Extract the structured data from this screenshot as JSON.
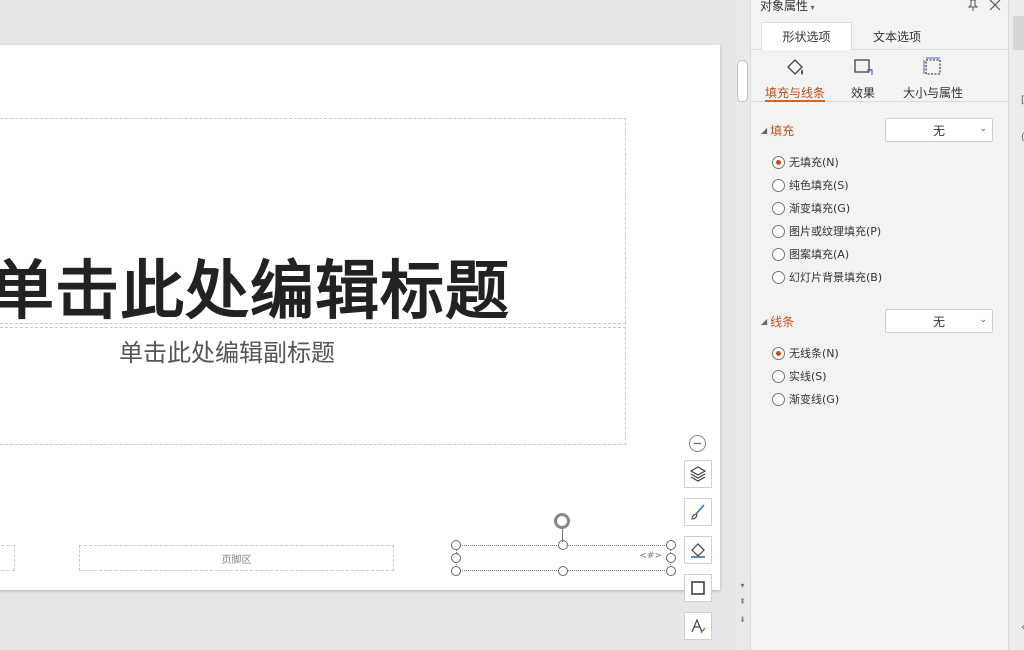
{
  "slide": {
    "title_text": "单击此处编辑标题",
    "subtitle_text": "单击此处编辑副标题",
    "footer_text": "页脚区",
    "number_text": "<#>"
  },
  "panel": {
    "title": "对象属性",
    "tabs": [
      {
        "label": "形状选项",
        "active": true
      },
      {
        "label": "文本选项",
        "active": false
      }
    ],
    "subtabs": [
      {
        "label": "填充与线条",
        "icon": "fill-line-icon",
        "active": true
      },
      {
        "label": "效果",
        "icon": "effect-icon",
        "active": false
      },
      {
        "label": "大小与属性",
        "icon": "size-property-icon",
        "active": false
      }
    ],
    "fill": {
      "heading": "填充",
      "combo_value": "无",
      "options": [
        {
          "label": "无填充(N)",
          "checked": true
        },
        {
          "label": "纯色填充(S)",
          "checked": false
        },
        {
          "label": "渐变填充(G)",
          "checked": false
        },
        {
          "label": "图片或纹理填充(P)",
          "checked": false
        },
        {
          "label": "图案填充(A)",
          "checked": false
        },
        {
          "label": "幻灯片背景填充(B)",
          "checked": false
        }
      ]
    },
    "line": {
      "heading": "线条",
      "combo_value": "无",
      "options": [
        {
          "label": "无线条(N)",
          "checked": true
        },
        {
          "label": "实线(S)",
          "checked": false
        },
        {
          "label": "渐变线(G)",
          "checked": false
        }
      ]
    }
  },
  "colors": {
    "accent": "#d9621e",
    "accent_text": "#c0501a",
    "panel_bg": "#f3f3f3",
    "canvas_bg": "#e6e6e6"
  }
}
